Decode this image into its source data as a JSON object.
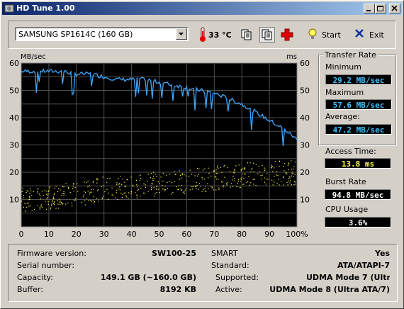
{
  "window": {
    "title": "HD Tune 1.00"
  },
  "toolbar": {
    "drive": "SAMSUNG SP1614C (160 GB)",
    "temperature": "33 °C",
    "start_label": "Start",
    "exit_label": "Exit"
  },
  "chart": {
    "left_unit": "MB/sec",
    "right_unit": "ms",
    "x_ticks": [
      "0",
      "10",
      "20",
      "30",
      "40",
      "50",
      "60",
      "70",
      "80",
      "90",
      "100%"
    ],
    "y_ticks": [
      "60",
      "50",
      "40",
      "30",
      "20",
      "10"
    ]
  },
  "chart_data": {
    "type": "line",
    "xlabel": "",
    "ylabel": "MB/sec",
    "y2label": "ms",
    "xlim": [
      0,
      100
    ],
    "ylim": [
      0,
      60
    ],
    "y2lim": [
      0,
      60
    ],
    "grid": true,
    "series": [
      {
        "axis": "left",
        "color": "#3fa8ff",
        "x": [
          0,
          5,
          10,
          15,
          20,
          25,
          30,
          35,
          40,
          45,
          50,
          55,
          60,
          65,
          70,
          75,
          80,
          85,
          90,
          95,
          100
        ],
        "y": [
          57,
          57,
          57,
          57,
          56,
          56,
          55,
          54,
          54,
          54,
          53,
          52,
          51,
          50,
          49,
          47,
          45,
          42,
          39,
          36,
          32
        ]
      },
      {
        "axis": "right",
        "type": "scatter",
        "color": "#ffff40",
        "x": [
          0,
          10,
          20,
          30,
          40,
          50,
          60,
          70,
          80,
          90
        ],
        "y": [
          10,
          11,
          12,
          14,
          15,
          16,
          17,
          18,
          19,
          20
        ]
      }
    ]
  },
  "side": {
    "transfer_rate_title": "Transfer Rate",
    "minimum_label": "Minimum",
    "minimum_value": "29.2 MB/sec",
    "maximum_label": "Maximum",
    "maximum_value": "57.6 MB/sec",
    "average_label": "Average:",
    "average_value": "47.2 MB/sec",
    "access_label": "Access Time:",
    "access_value": "13.8 ms",
    "burst_label": "Burst Rate",
    "burst_value": "94.8 MB/sec",
    "cpu_label": "CPU Usage",
    "cpu_value": "3.6%"
  },
  "info": {
    "firmware_label": "Firmware version:",
    "firmware_value": "SW100-25",
    "serial_label": "Serial number:",
    "serial_value": "",
    "capacity_label": "Capacity:",
    "capacity_value": "149.1 GB (~160.0 GB)",
    "buffer_label": "Buffer:",
    "buffer_value": "8192 KB",
    "smart_label": "SMART",
    "smart_value": "Yes",
    "standard_label": "Standard:",
    "standard_value": "ATA/ATAPI-7",
    "supported_label": "Supported:",
    "supported_value": "UDMA Mode 7 (Ultra",
    "active_label": "Active:",
    "active_value": "UDMA Mode 8 (Ultra ATA/7)"
  }
}
